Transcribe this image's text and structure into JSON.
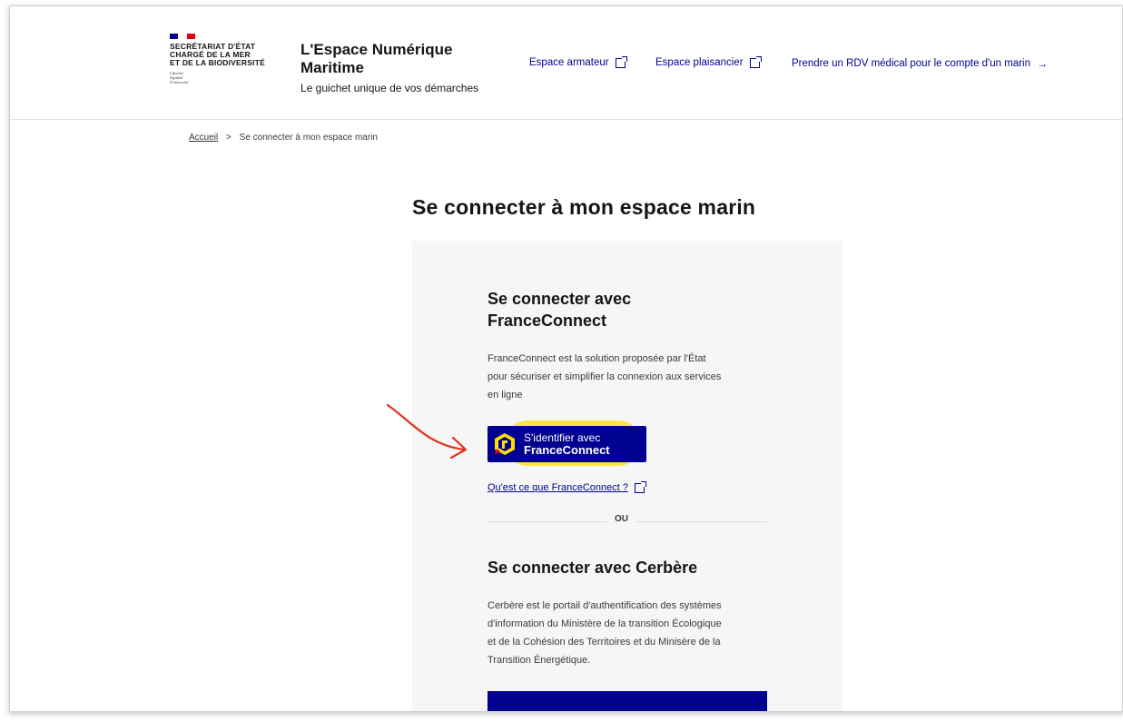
{
  "header": {
    "org_lines": [
      "Secrétariat d'État",
      "chargé de la mer",
      "et de la biodiversité"
    ],
    "devise": [
      "Liberté",
      "Égalité",
      "Fraternité"
    ],
    "site_title_line1": "L'Espace Numérique",
    "site_title_line2": "Maritime",
    "tagline": "Le guichet unique de vos démarches",
    "nav": {
      "armateur": "Espace armateur",
      "plaisancier": "Espace plaisancier",
      "rdv": "Prendre un RDV médical pour le compte d'un marin"
    }
  },
  "breadcrumb": {
    "home": "Accueil",
    "separator": ">",
    "current": "Se connecter à mon espace marin"
  },
  "page_title": "Se connecter à mon espace marin",
  "franceconnect": {
    "heading_line1": "Se connecter avec",
    "heading_line2": "FranceConnect",
    "description_lines": [
      "FranceConnect est la solution proposée par l'État",
      "pour sécuriser et simplifier la connexion aux services",
      "en ligne"
    ],
    "button_line1": "S'identifier avec",
    "button_line2": "FranceConnect",
    "help_link": "Qu'est ce que FranceConnect ?"
  },
  "separator_text": "OU",
  "cerbere": {
    "heading": "Se connecter avec Cerbère",
    "description_lines": [
      "Cerbère est le portail d'authentification des systèmes",
      "d'information du Ministère de la transition Écologique",
      "et de la Cohésion des Territoires et du Minisère de la",
      "Transition Énergétique."
    ]
  },
  "colors": {
    "primary": "#000091",
    "panel_bg": "#f6f6f6",
    "highlight": "#ffe000",
    "annotation": "#e2311d"
  },
  "icons": {
    "external": "external-link-icon",
    "arrow": "arrow-right-icon",
    "franceconnect_logo": "franceconnect-logo-icon",
    "annotation_arrow": "red-annotation-arrow-icon"
  }
}
